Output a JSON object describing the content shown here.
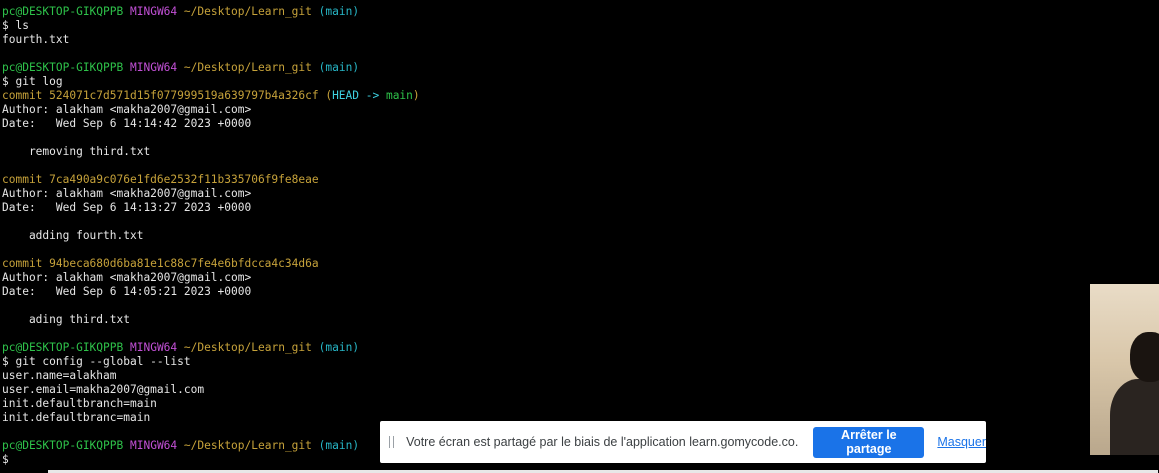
{
  "terminal": {
    "prompt": {
      "user": "pc@DESKTOP-GIKQPPB",
      "env": "MINGW64",
      "path": "~/Desktop/Learn_git",
      "branch": "(main)"
    },
    "blocks": [
      {
        "command": "$ ls",
        "output": [
          "fourth.txt"
        ]
      },
      {
        "command": "$ git log",
        "commits": [
          {
            "hash": "commit 524071c7d571d15f077999519a639797b4a326cf",
            "refs_open": " (",
            "refs_head": "HEAD -> ",
            "refs_branch": "main",
            "refs_close": ")",
            "author": "Author: alakham <makha2007@gmail.com>",
            "date": "Date:   Wed Sep 6 14:14:42 2023 +0000",
            "message": "    removing third.txt"
          },
          {
            "hash": "commit 7ca490a9c076e1fd6e2532f11b335706f9fe8eae",
            "author": "Author: alakham <makha2007@gmail.com>",
            "date": "Date:   Wed Sep 6 14:13:27 2023 +0000",
            "message": "    adding fourth.txt"
          },
          {
            "hash": "commit 94beca680d6ba81e1c88c7fe4e6bfdcca4c34d6a",
            "author": "Author: alakham <makha2007@gmail.com>",
            "date": "Date:   Wed Sep 6 14:05:21 2023 +0000",
            "message": "    ading third.txt"
          }
        ]
      },
      {
        "command": "$ git config --global --list",
        "output": [
          "user.name=alakham",
          "user.email=makha2007@gmail.com",
          "init.defaultbranch=main",
          "init.defaultbranc=main"
        ]
      }
    ],
    "final_prompt_cursor": "$"
  },
  "share_bar": {
    "message": "Votre écran est partagé par le biais de l'application learn.gomycode.co.",
    "stop_label": "Arrêter le partage",
    "hide_label": "Masquer"
  },
  "colors": {
    "prompt_user": "#2ec24a",
    "prompt_env": "#c250d6",
    "prompt_path": "#c6a23a",
    "prompt_branch": "#27b6c6",
    "commit_hash": "#c6a23a",
    "share_button": "#1a73e8"
  }
}
